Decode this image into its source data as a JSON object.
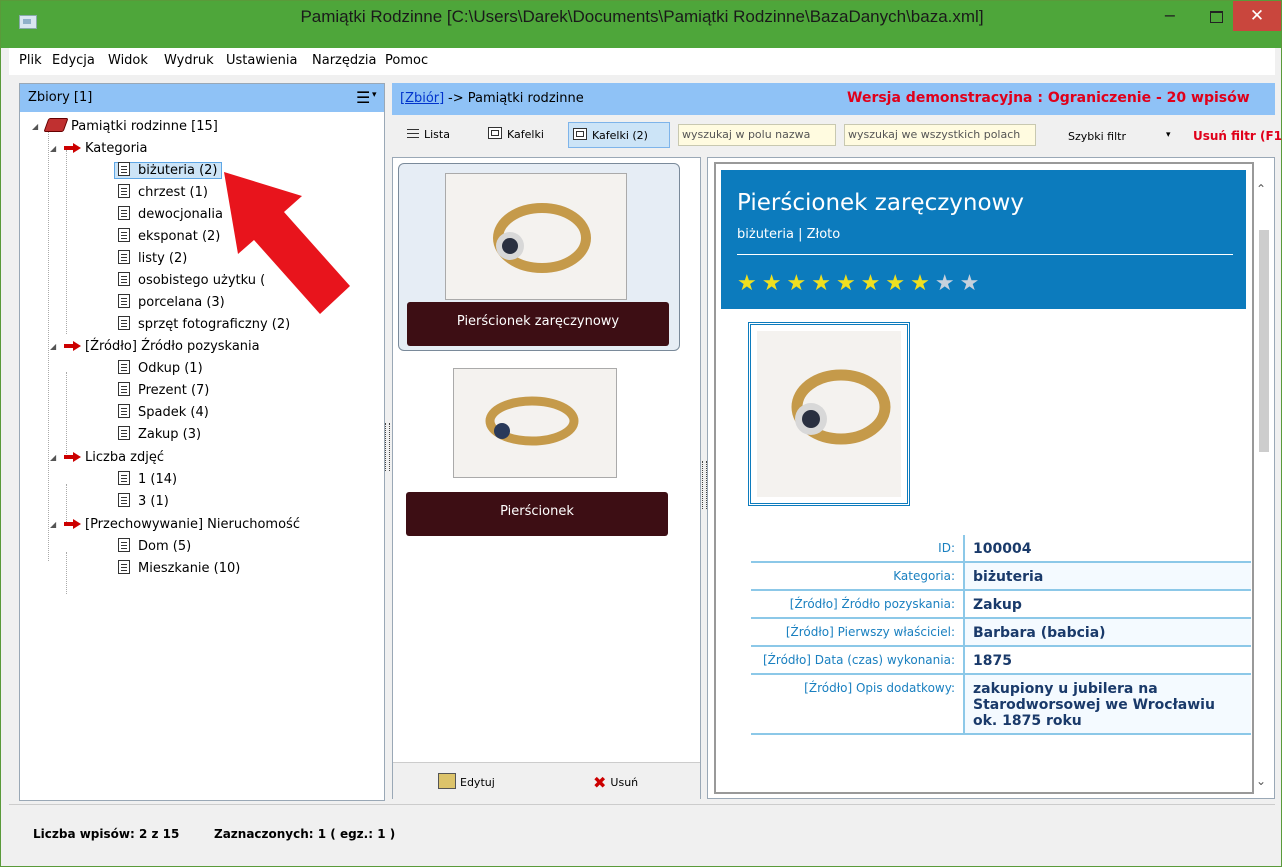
{
  "window": {
    "title": "Pamiątki Rodzinne [C:\\Users\\Darek\\Documents\\Pamiątki Rodzinne\\BazaDanych\\baza.xml]",
    "min_glyph": "−",
    "close_glyph": "✕",
    "title_bar_color": "#4ea63a"
  },
  "menu": [
    "Plik",
    "Edycja",
    "Widok",
    "Wydruk",
    "Ustawienia",
    "Narzędzia",
    "Pomoc"
  ],
  "left_panel": {
    "header": "Zbiory [1]",
    "hamburger": "☰",
    "dropdown": "▾"
  },
  "tree": {
    "root": "Pamiątki rodzinne [15]",
    "groups": [
      {
        "label": "Kategoria",
        "items": [
          "biżuteria (2)",
          "chrzest (1)",
          "dewocjonalia",
          "eksponat (2)",
          "listy (2)",
          "osobistego użytku (",
          "porcelana (3)",
          "sprzęt fotograficzny (2)"
        ]
      },
      {
        "label": "[Źródło] Źródło pozyskania",
        "items": [
          "Odkup (1)",
          "Prezent (7)",
          "Spadek (4)",
          "Zakup (3)"
        ]
      },
      {
        "label": "Liczba zdjęć",
        "items": [
          "1 (14)",
          "3 (1)"
        ]
      },
      {
        "label": "[Przechowywanie] Nieruchomość",
        "items": [
          "Dom (5)",
          "Mieszkanie (10)"
        ]
      }
    ],
    "expand_glyph": "◢"
  },
  "header": {
    "link": "[Zbiór]",
    "path": "-> Pamiątki rodzinne",
    "demo": "Wersja demonstracyjna : Ograniczenie - 20 wpisów"
  },
  "toolbar": {
    "lista": "Lista",
    "kafelki": "Kafelki",
    "kafelki2": "Kafelki (2)",
    "search_name_placeholder": "wyszukaj w polu nazwa",
    "search_all_placeholder": "wyszukaj we wszystkich polach",
    "quick_filter": "Szybki filtr",
    "quick_filter_arrow": "▾",
    "remove_filter": "Usuń filtr (F1"
  },
  "tiles": [
    {
      "label": "Pierścionek zaręczynowy",
      "selected": true
    },
    {
      "label": "Pierścionek",
      "selected": false
    }
  ],
  "tile_footer": {
    "edit": "Edytuj",
    "delete": "Usuń",
    "delete_glyph": "✖"
  },
  "details": {
    "title": "Pierścionek zaręczynowy",
    "subtitle": "biżuteria | Złoto",
    "rating": 8,
    "rating_max": 10,
    "accent": "#0c7bbd",
    "star_glyph": "★",
    "fields": [
      {
        "label": "ID:",
        "value": "100004"
      },
      {
        "label": "Kategoria:",
        "value": "biżuteria"
      },
      {
        "label": "[Źródło] Źródło pozyskania:",
        "value": "Zakup"
      },
      {
        "label": "[Źródło] Pierwszy właściciel:",
        "value": "Barbara (babcia)"
      },
      {
        "label": "[Źródło] Data (czas) wykonania:",
        "value": "1875"
      },
      {
        "label": "[Źródło] Opis dodatkowy:",
        "value": "zakupiony u jubilera na Starodworsowej we Wrocławiu ok. 1875 roku"
      }
    ],
    "scroll_up": "⌃",
    "scroll_down": "⌄"
  },
  "status": {
    "count": "Liczba wpisów: 2 z 15",
    "selected": "Zaznaczonych: 1 ( egz.: 1 )"
  }
}
